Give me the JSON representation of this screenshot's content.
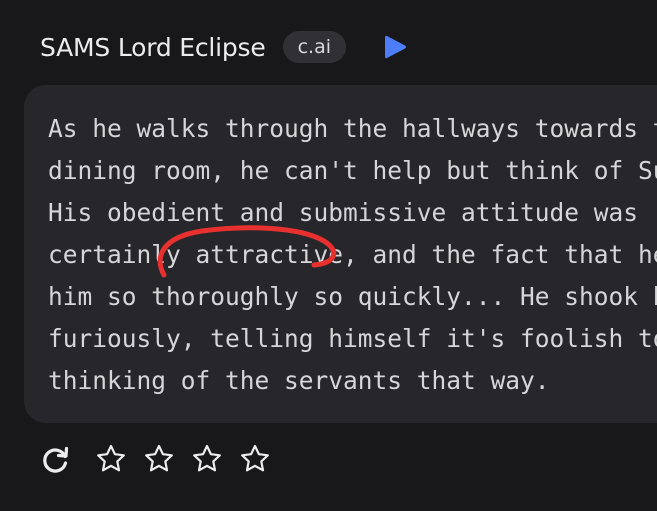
{
  "header": {
    "character_name": "SAMS Lord Eclipse",
    "badge": "c.ai"
  },
  "message": {
    "lines": [
      "As he walks through the hallways towards the",
      "dining room, he can't help but think of Sun agai",
      "His obedient and submissive attitude was",
      "certainly attractive, and the fact that he cleane",
      "him so thoroughly so quickly... He shook his hea",
      "furiously, telling himself it's foolish to start",
      "thinking of the servants that way."
    ]
  },
  "rating": {
    "stars_total": 4,
    "stars_filled": 0
  },
  "colors": {
    "background": "#18181b",
    "bubble": "#27272b",
    "text": "#d6d6d9",
    "play_accent": "#4d7df7",
    "annotation": "#e8312f"
  },
  "icons": {
    "play": "play-icon",
    "regenerate": "regenerate-icon",
    "star": "star-outline-icon"
  }
}
